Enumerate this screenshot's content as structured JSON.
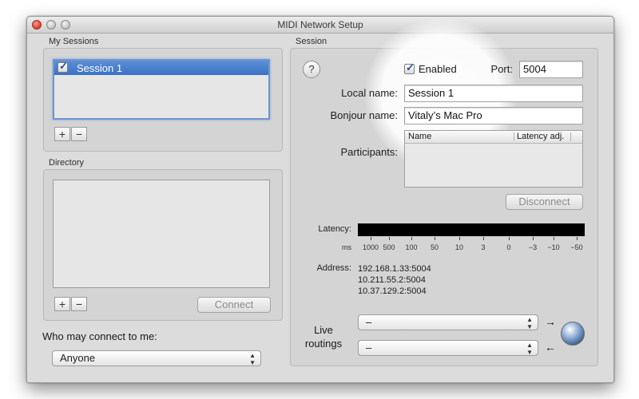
{
  "window": {
    "title": "MIDI Network Setup"
  },
  "my_sessions": {
    "label": "My Sessions",
    "items": [
      {
        "label": "Session 1",
        "checked": true,
        "selected": true
      }
    ],
    "add_label": "+",
    "remove_label": "−"
  },
  "directory": {
    "label": "Directory",
    "add_label": "+",
    "remove_label": "−",
    "connect_label": "Connect"
  },
  "who_may_connect": {
    "label": "Who may connect to me:",
    "selected": "Anyone"
  },
  "session": {
    "label": "Session",
    "help_label": "?",
    "enabled_label": "Enabled",
    "enabled_checked": true,
    "port_label": "Port:",
    "port_value": "5004",
    "local_name_label": "Local name:",
    "local_name_value": "Session 1",
    "bonjour_name_label": "Bonjour name:",
    "bonjour_name_value": "Vitaly’s Mac Pro",
    "participants_label": "Participants:",
    "participants_columns": [
      "Name",
      "Latency adj."
    ],
    "disconnect_label": "Disconnect",
    "latency_label": "Latency:",
    "latency_unit": "ms",
    "latency_ticks": [
      "1000",
      "500",
      "100",
      "50",
      "10",
      "3",
      "0",
      "−3",
      "−10",
      "−50"
    ],
    "address_label": "Address:",
    "addresses": [
      "192.168.1.33:5004",
      "10.211.55.2:5004",
      "10.37.129.2:5004"
    ],
    "live_routings_label_1": "Live",
    "live_routings_label_2": "routings",
    "routing_out_value": "–",
    "routing_in_value": "–",
    "routing_out_arrow": "→",
    "routing_in_arrow": "←",
    "globe_icon": "network-globe-icon"
  },
  "colors": {
    "selection": "#3b72c4",
    "window_bg": "#dcdcdc",
    "focus_ring": "#6f95cf"
  }
}
